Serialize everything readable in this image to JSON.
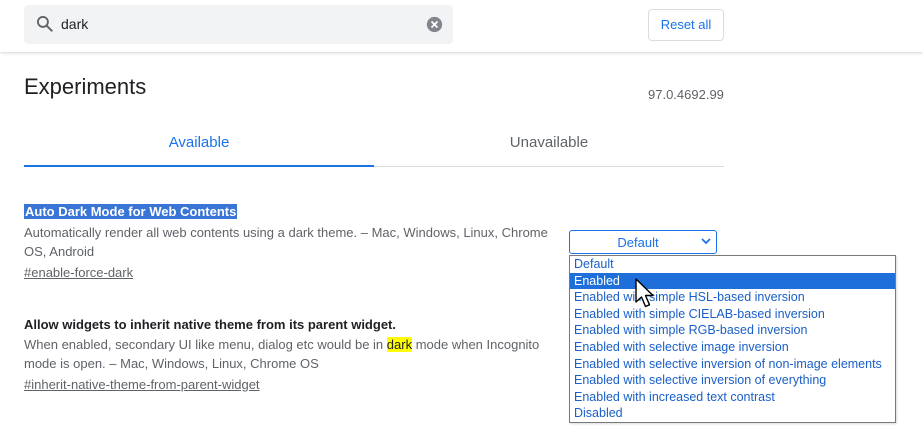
{
  "search": {
    "value": "dark"
  },
  "header": {
    "reset_label": "Reset all"
  },
  "page": {
    "title": "Experiments",
    "version": "97.0.4692.99"
  },
  "tabs": [
    {
      "label": "Available",
      "active": true
    },
    {
      "label": "Unavailable",
      "active": false
    }
  ],
  "experiments": [
    {
      "title": "Auto Dark Mode for Web Contents",
      "description_line1": "Automatically render all web contents using a dark theme. – Mac, Windows, Linux, Chrome",
      "description_line2": "OS, Android",
      "link": "#enable-force-dark",
      "select_value": "Default"
    },
    {
      "title": "Allow widgets to inherit native theme from its parent widget.",
      "description_pre": "When enabled, secondary UI like menu, dialog etc would be in ",
      "description_mark": "dark",
      "description_post": " mode when Incognito",
      "description_line2": "mode is open. – Mac, Windows, Linux, Chrome OS",
      "link": "#inherit-native-theme-from-parent-widget"
    }
  ],
  "dropdown": {
    "options": [
      "Default",
      "Enabled",
      "Enabled with simple HSL-based inversion",
      "Enabled with simple CIELAB-based inversion",
      "Enabled with simple RGB-based inversion",
      "Enabled with selective image inversion",
      "Enabled with selective inversion of non-image elements",
      "Enabled with selective inversion of everything",
      "Enabled with increased text contrast",
      "Disabled"
    ],
    "highlighted": "Enabled"
  },
  "colors": {
    "accent": "#1a73e8",
    "selection": "#3875d7",
    "search_highlight": "#ffff00"
  }
}
